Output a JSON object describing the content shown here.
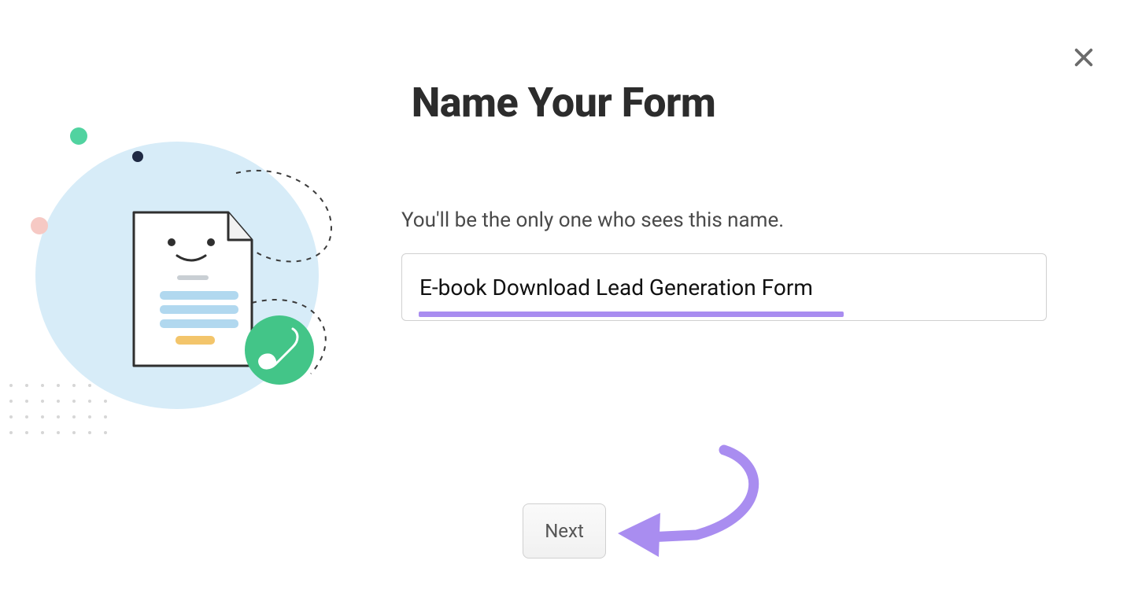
{
  "modal": {
    "title": "Name Your Form",
    "subtitle": "You'll be the only one who sees this name.",
    "input_value": "E-book Download Lead Generation Form",
    "next_label": "Next"
  },
  "icons": {
    "close": "close-icon",
    "illustration": "form-document-brush-illustration",
    "arrow": "annotation-arrow"
  },
  "colors": {
    "annotation": "#a98df0",
    "accent_green": "#43c588",
    "light_blue": "#d7ecf8",
    "mid_blue": "#b1d8ef"
  }
}
